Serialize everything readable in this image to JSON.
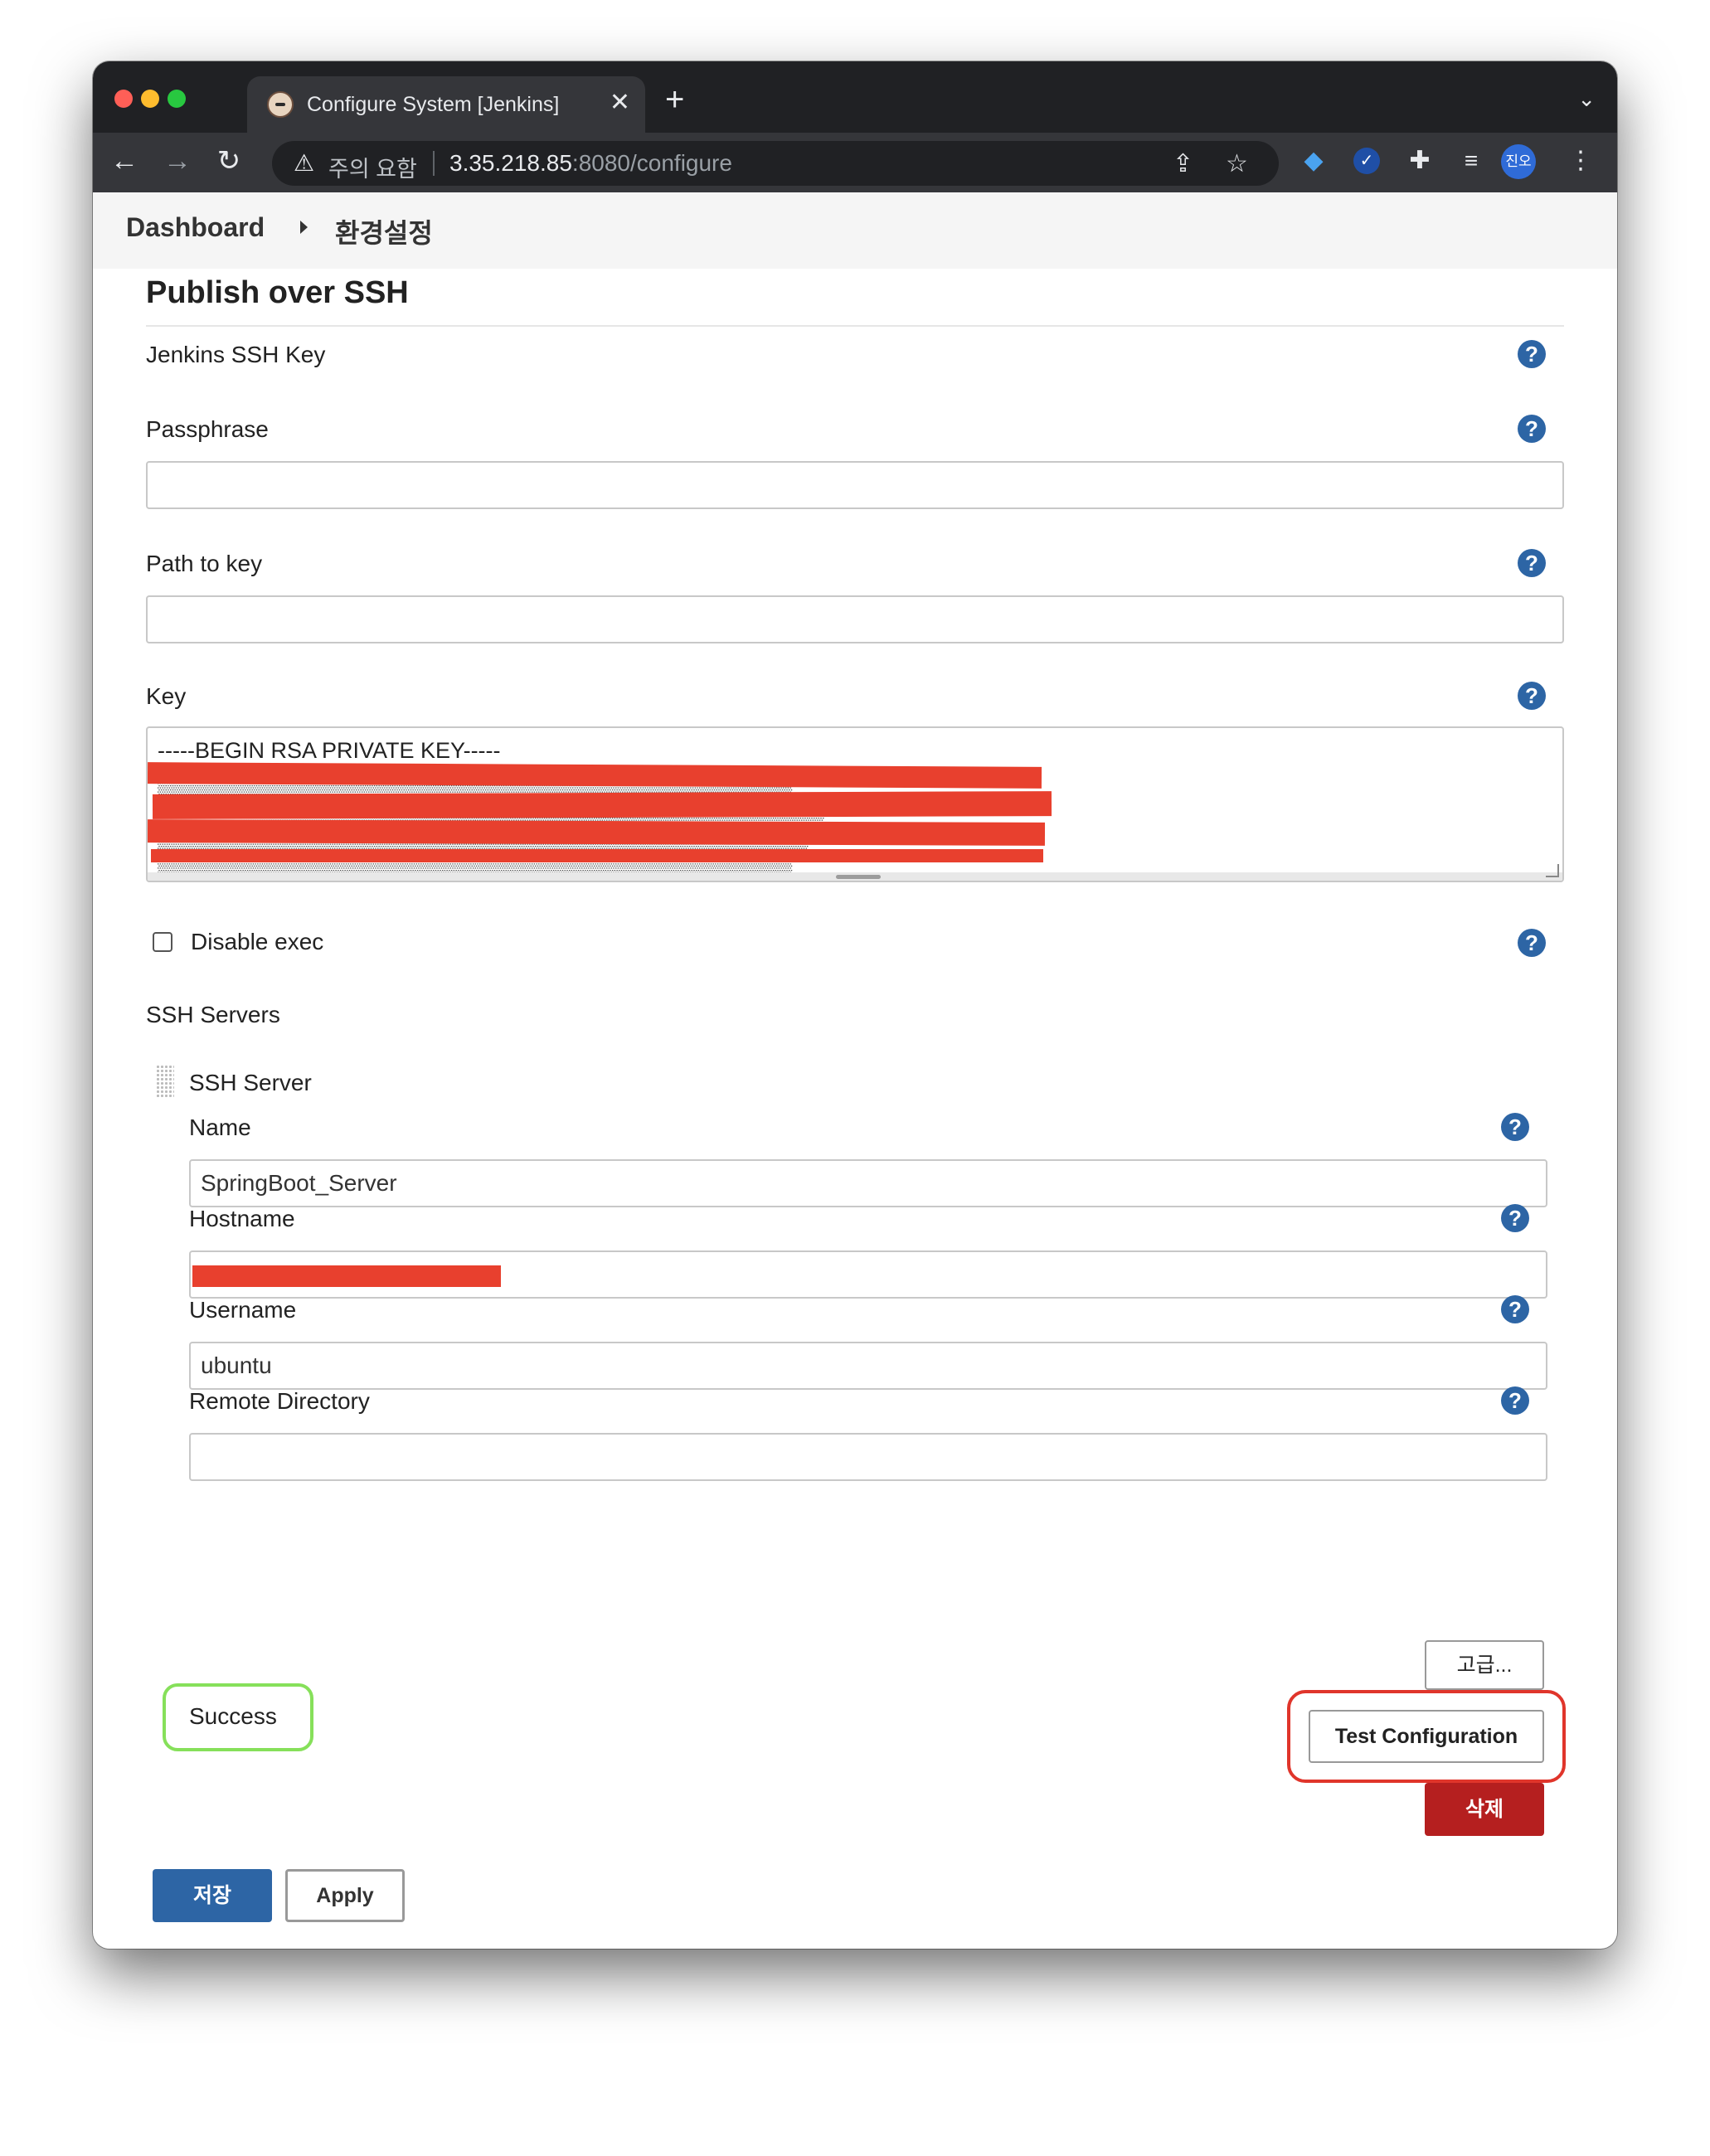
{
  "browser": {
    "tab_title": "Configure System [Jenkins]",
    "security_label": "주의 요함",
    "url_host": "3.35.218.85",
    "url_rest": ":8080/configure",
    "profile_initials": "진오"
  },
  "breadcrumb": {
    "items": [
      "Dashboard",
      "환경설정"
    ]
  },
  "section": {
    "title": "Publish over SSH",
    "jenkins_ssh_key_label": "Jenkins SSH Key",
    "passphrase_label": "Passphrase",
    "passphrase_value": "",
    "path_to_key_label": "Path to key",
    "path_to_key_value": "",
    "key_label": "Key",
    "key_first_line": "-----BEGIN RSA PRIVATE KEY-----",
    "disable_exec_label": "Disable exec",
    "disable_exec_checked": false,
    "ssh_servers_label": "SSH Servers"
  },
  "server": {
    "header": "SSH Server",
    "name_label": "Name",
    "name_value": "SpringBoot_Server",
    "hostname_label": "Hostname",
    "hostname_value": "",
    "username_label": "Username",
    "username_value": "ubuntu",
    "remote_dir_label": "Remote Directory",
    "remote_dir_value": ""
  },
  "actions": {
    "advanced": "고급...",
    "test_configuration": "Test Configuration",
    "delete": "삭제",
    "result": "Success",
    "save": "저장",
    "apply": "Apply"
  },
  "colors": {
    "help_icon": "#2d65a5",
    "delete_button": "#b51f1f",
    "save_button": "#2d65a5",
    "highlight_red": "#e0352b",
    "highlight_green": "#86e05a",
    "redaction": "#e8402e"
  },
  "icons": [
    "close-icon",
    "plus-icon",
    "chevron-down-icon",
    "back-arrow-icon",
    "forward-arrow-icon",
    "reload-icon",
    "warning-icon",
    "share-icon",
    "star-icon",
    "extension-gem-icon",
    "extension-check-icon",
    "puzzle-icon",
    "media-control-icon",
    "menu-kebab-icon",
    "help-icon",
    "drag-handle-icon"
  ]
}
